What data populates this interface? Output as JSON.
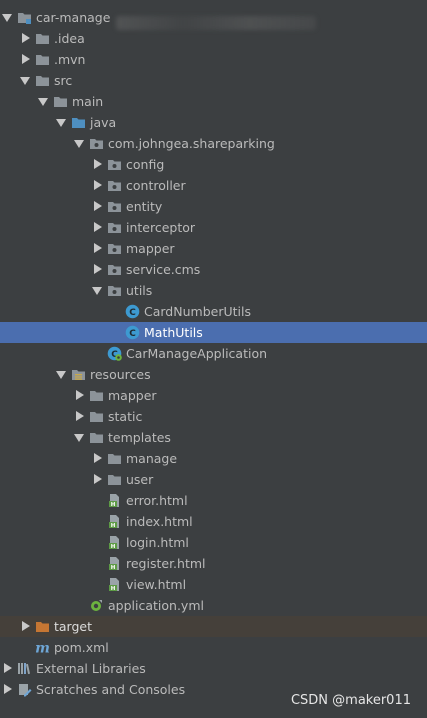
{
  "tree": [
    {
      "label": "car-manage",
      "depth": 0,
      "expand": "down",
      "icon": "module-folder-icon",
      "redacted": true
    },
    {
      "label": ".idea",
      "depth": 1,
      "expand": "right",
      "icon": "folder-icon"
    },
    {
      "label": ".mvn",
      "depth": 1,
      "expand": "right",
      "icon": "folder-icon"
    },
    {
      "label": "src",
      "depth": 1,
      "expand": "down",
      "icon": "folder-icon"
    },
    {
      "label": "main",
      "depth": 2,
      "expand": "down",
      "icon": "folder-icon"
    },
    {
      "label": "java",
      "depth": 3,
      "expand": "down",
      "icon": "source-folder-icon"
    },
    {
      "label": "com.johngea.shareparking",
      "depth": 4,
      "expand": "down",
      "icon": "package-icon"
    },
    {
      "label": "config",
      "depth": 5,
      "expand": "right",
      "icon": "package-icon"
    },
    {
      "label": "controller",
      "depth": 5,
      "expand": "right",
      "icon": "package-icon"
    },
    {
      "label": "entity",
      "depth": 5,
      "expand": "right",
      "icon": "package-icon"
    },
    {
      "label": "interceptor",
      "depth": 5,
      "expand": "right",
      "icon": "package-icon"
    },
    {
      "label": "mapper",
      "depth": 5,
      "expand": "right",
      "icon": "package-icon"
    },
    {
      "label": "service.cms",
      "depth": 5,
      "expand": "right",
      "icon": "package-icon"
    },
    {
      "label": "utils",
      "depth": 5,
      "expand": "down",
      "icon": "package-icon"
    },
    {
      "label": "CardNumberUtils",
      "depth": 6,
      "expand": "none",
      "icon": "class-icon"
    },
    {
      "label": "MathUtils",
      "depth": 6,
      "expand": "none",
      "icon": "class-icon",
      "selected": true
    },
    {
      "label": "CarManageApplication",
      "depth": 5,
      "expand": "none",
      "icon": "spring-boot-class-icon"
    },
    {
      "label": "resources",
      "depth": 3,
      "expand": "down",
      "icon": "resources-folder-icon"
    },
    {
      "label": "mapper",
      "depth": 4,
      "expand": "right",
      "icon": "folder-icon"
    },
    {
      "label": "static",
      "depth": 4,
      "expand": "right",
      "icon": "folder-icon"
    },
    {
      "label": "templates",
      "depth": 4,
      "expand": "down",
      "icon": "folder-icon"
    },
    {
      "label": "manage",
      "depth": 5,
      "expand": "right",
      "icon": "folder-icon"
    },
    {
      "label": "user",
      "depth": 5,
      "expand": "right",
      "icon": "folder-icon"
    },
    {
      "label": "error.html",
      "depth": 5,
      "expand": "none",
      "icon": "html-file-icon"
    },
    {
      "label": "index.html",
      "depth": 5,
      "expand": "none",
      "icon": "html-file-icon"
    },
    {
      "label": "login.html",
      "depth": 5,
      "expand": "none",
      "icon": "html-file-icon"
    },
    {
      "label": "register.html",
      "depth": 5,
      "expand": "none",
      "icon": "html-file-icon"
    },
    {
      "label": "view.html",
      "depth": 5,
      "expand": "none",
      "icon": "html-file-icon"
    },
    {
      "label": "application.yml",
      "depth": 4,
      "expand": "none",
      "icon": "spring-yml-icon"
    },
    {
      "label": "target",
      "depth": 1,
      "expand": "right",
      "icon": "excluded-folder-icon",
      "excluded": true
    },
    {
      "label": "pom.xml",
      "depth": 1,
      "expand": "none",
      "icon": "maven-icon"
    },
    {
      "label": "External Libraries",
      "depth": 0,
      "expand": "right",
      "icon": "libraries-icon"
    },
    {
      "label": "Scratches and Consoles",
      "depth": 0,
      "expand": "right",
      "icon": "scratches-icon"
    }
  ],
  "watermark": "CSDN @maker011",
  "colors": {
    "background": "#3c3f41",
    "selection": "#4b6eaf",
    "excluded_row": "#45403a",
    "folder": "#8c9399",
    "source_folder": "#4e8fc0",
    "excluded_folder": "#c57633",
    "class_icon": "#3d9ad1",
    "html_icon": "#5d9b45"
  }
}
